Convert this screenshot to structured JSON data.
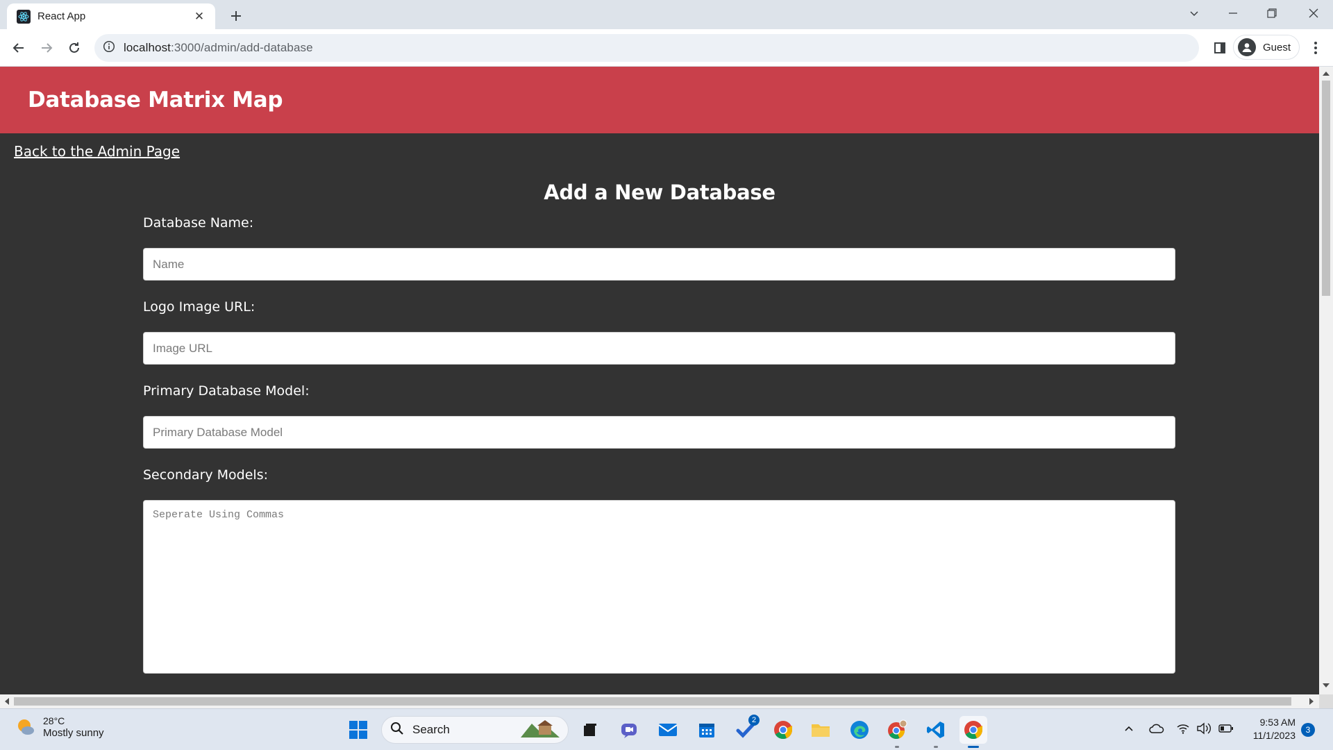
{
  "browser": {
    "tab_title": "React App",
    "url_host": "localhost",
    "url_path": ":3000/admin/add-database",
    "profile_label": "Guest"
  },
  "app": {
    "title": "Database Matrix Map",
    "back_link": "Back to the Admin Page",
    "form_title": "Add a New Database",
    "fields": {
      "name": {
        "label": "Database Name:",
        "placeholder": "Name",
        "value": ""
      },
      "logo": {
        "label": "Logo Image URL:",
        "placeholder": "Image URL",
        "value": ""
      },
      "primary": {
        "label": "Primary Database Model:",
        "placeholder": "Primary Database Model",
        "value": ""
      },
      "secondary": {
        "label": "Secondary Models:",
        "placeholder": "Seperate Using Commas",
        "value": ""
      }
    }
  },
  "taskbar": {
    "weather_temp": "28°C",
    "weather_desc": "Mostly sunny",
    "search_label": "Search",
    "todo_badge": "2",
    "time": "9:53 AM",
    "date": "11/1/2023",
    "notification_count": "3"
  },
  "colors": {
    "header_red": "#c9404b",
    "page_bg": "#333333",
    "accent_blue": "#005fb8"
  }
}
